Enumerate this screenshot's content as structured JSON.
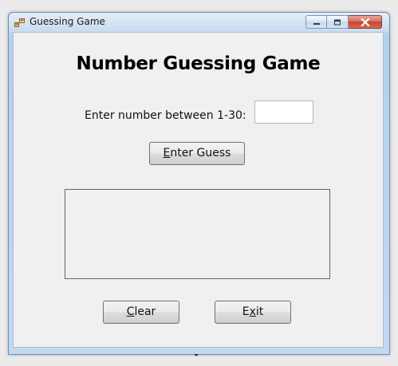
{
  "window": {
    "title": "Guessing Game",
    "app_icon": "app-icon",
    "controls": {
      "minimize_icon": "minimize-icon",
      "maximize_icon": "maximize-icon",
      "close_icon": "close-icon"
    }
  },
  "form": {
    "heading": "Number Guessing Game",
    "prompt_label": "Enter number between 1-30:",
    "guess_value": "",
    "output_text": ""
  },
  "buttons": {
    "enter_guess": {
      "mnemonic": "E",
      "rest": "nter Guess"
    },
    "clear": {
      "mnemonic": "C",
      "rest": "lear"
    },
    "exit": {
      "before": "E",
      "mnemonic": "x",
      "after": "it"
    }
  },
  "colors": {
    "close_button": "#c8442d",
    "client_background": "#f0f0f0",
    "titlebar": "#d6e4f3"
  }
}
